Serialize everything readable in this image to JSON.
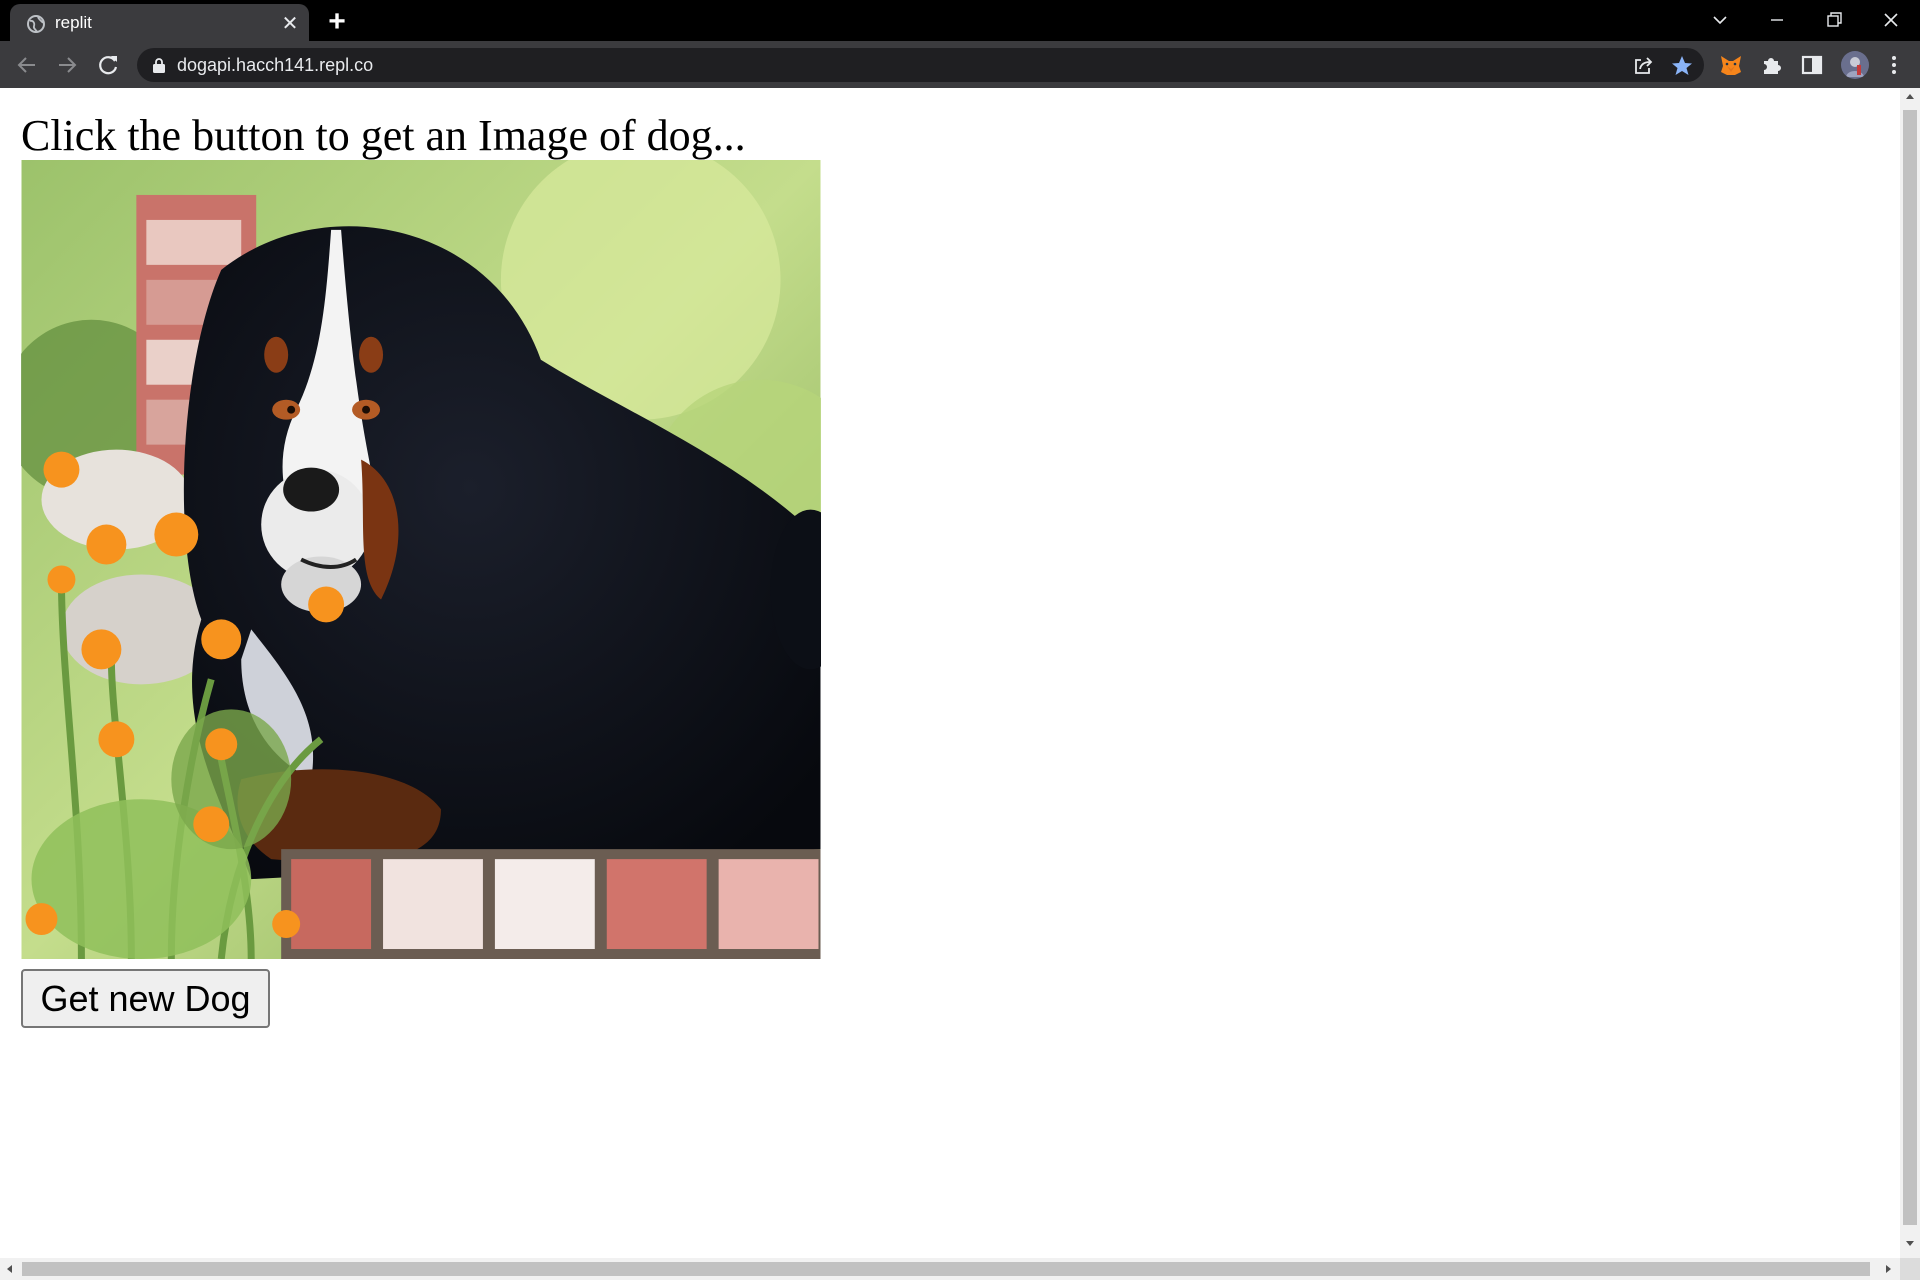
{
  "browser": {
    "tab_title": "replit",
    "url": "dogapi.hacch141.repl.co"
  },
  "page": {
    "heading": "Click the button to get an Image of dog...",
    "button_label": "Get new Dog"
  },
  "colors": {
    "titlebar": "#000000",
    "toolbar": "#3b3b3e",
    "omnibox": "#1f1f22",
    "star": "#8ab4f8",
    "metamask": "#f6851b"
  }
}
